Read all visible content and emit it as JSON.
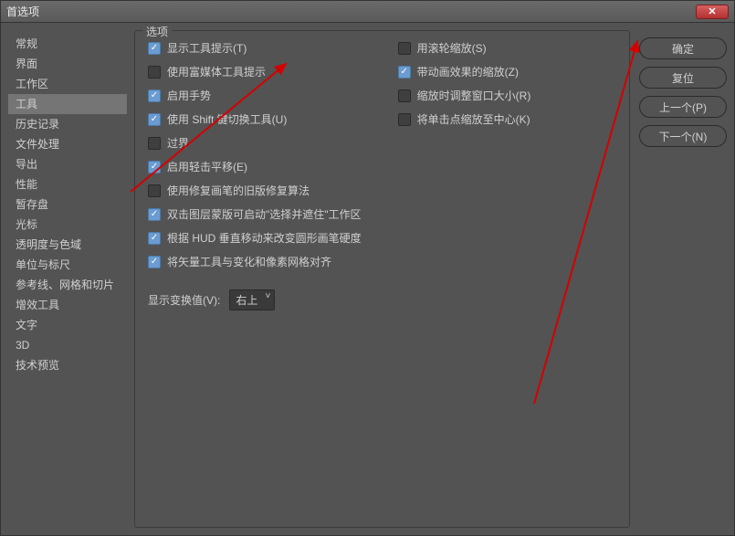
{
  "window": {
    "title": "首选项"
  },
  "sidebar": {
    "items": [
      {
        "label": "常规"
      },
      {
        "label": "界面"
      },
      {
        "label": "工作区"
      },
      {
        "label": "工具"
      },
      {
        "label": "历史记录"
      },
      {
        "label": "文件处理"
      },
      {
        "label": "导出"
      },
      {
        "label": "性能"
      },
      {
        "label": "暂存盘"
      },
      {
        "label": "光标"
      },
      {
        "label": "透明度与色域"
      },
      {
        "label": "单位与标尺"
      },
      {
        "label": "参考线、网格和切片"
      },
      {
        "label": "增效工具"
      },
      {
        "label": "文字"
      },
      {
        "label": "3D"
      },
      {
        "label": "技术预览"
      }
    ],
    "activeIndex": 3
  },
  "panel": {
    "header": "选项"
  },
  "options_left": [
    {
      "checked": true,
      "label": "显示工具提示(T)"
    },
    {
      "checked": false,
      "label": "使用富媒体工具提示"
    },
    {
      "checked": true,
      "label": "启用手势"
    },
    {
      "checked": true,
      "label": "使用 Shift 键切换工具(U)"
    },
    {
      "checked": false,
      "label": "过界"
    },
    {
      "checked": true,
      "label": "启用轻击平移(E)"
    },
    {
      "checked": false,
      "label": "使用修复画笔的旧版修复算法"
    },
    {
      "checked": true,
      "label": "双击图层蒙版可启动\"选择并遮住\"工作区"
    },
    {
      "checked": true,
      "label": "根据 HUD 垂直移动来改变圆形画笔硬度"
    },
    {
      "checked": true,
      "label": "将矢量工具与变化和像素网格对齐"
    }
  ],
  "options_right": [
    {
      "checked": false,
      "label": "用滚轮缩放(S)"
    },
    {
      "checked": true,
      "label": "带动画效果的缩放(Z)"
    },
    {
      "checked": false,
      "label": "缩放时调整窗口大小(R)"
    },
    {
      "checked": false,
      "label": "将单击点缩放至中心(K)"
    }
  ],
  "transform": {
    "label": "显示变换值(V):",
    "value": "右上"
  },
  "buttons": {
    "ok": "确定",
    "reset": "复位",
    "prev": "上一个(P)",
    "next": "下一个(N)"
  }
}
